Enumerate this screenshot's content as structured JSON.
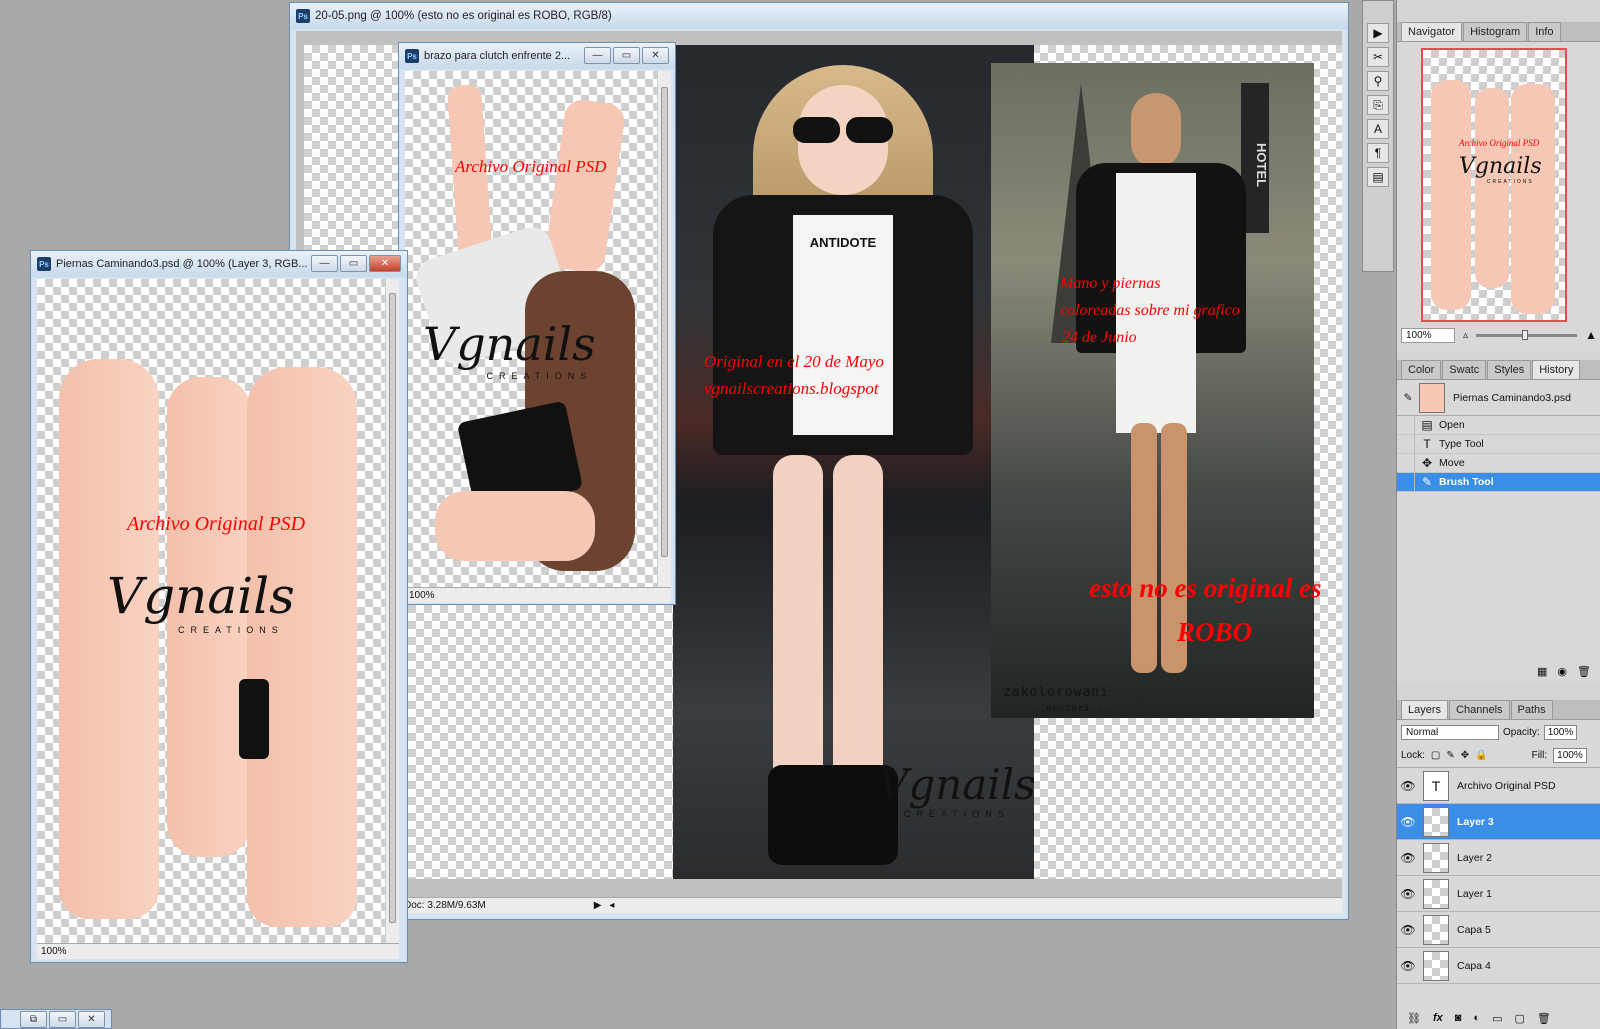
{
  "main_doc": {
    "title": "20-05.png @ 100% (esto no es original es ROBO, RGB/8)",
    "status_doc": "Doc: 3.28M/9.63M",
    "text_original": "Original en el 20 de Mayo",
    "text_blog": "vgnailscreations.blogspot",
    "text_mano": "Mano y piernas",
    "text_coloreadas": "coloreadas sobre mi grafico",
    "text_fecha": "24 de Junio",
    "text_robo1": "esto no es original es",
    "text_robo2": "ROBO",
    "tshirt_text": "ANTIDOTE",
    "hotel_sign": "HOTEL",
    "watermark": "zakolorowani",
    "watermark_sub": "..venturi...",
    "logo": "Vgnails",
    "logo_sub": "CREATIONS"
  },
  "brazo_doc": {
    "title": "brazo para clutch enfrente 2...",
    "text": "Archivo Original PSD",
    "logo": "Vgnails",
    "logo_sub": "CREATIONS",
    "zoom": "100%"
  },
  "piernas_doc": {
    "title": "Piernas Caminando3.psd @ 100% (Layer 3, RGB...",
    "text": "Archivo Original PSD",
    "logo": "Vgnails",
    "logo_sub": "CREATIONS",
    "zoom": "100%"
  },
  "navigator": {
    "tabs": [
      "Navigator",
      "Histogram",
      "Info"
    ],
    "text": "Archivo Original PSD",
    "logo": "Vgnails",
    "logo_sub": "CREATIONS",
    "zoom": "100%"
  },
  "history": {
    "tabs": [
      "Color",
      "Swatc",
      "Styles",
      "History"
    ],
    "snapshot": "Piernas Caminando3.psd",
    "items": [
      "Open",
      "Type Tool",
      "Move",
      "Brush Tool"
    ]
  },
  "layers": {
    "tabs": [
      "Layers",
      "Channels",
      "Paths"
    ],
    "blend_mode": "Normal",
    "opacity_label": "Opacity:",
    "opacity": "100%",
    "lock_label": "Lock:",
    "fill_label": "Fill:",
    "fill": "100%",
    "items": [
      "Archivo Original PSD",
      "Layer 3",
      "Layer 2",
      "Layer 1",
      "Capa 5",
      "Capa 4"
    ],
    "footer_icons": [
      "link-icon",
      "fx-icon",
      "mask-icon",
      "adjustment-icon",
      "folder-icon",
      "new-layer-icon",
      "trash-icon"
    ]
  },
  "colors": {
    "accent": "#3a8ee6",
    "watermark_red": "#ff0000",
    "skin": "#f6c7b4"
  }
}
